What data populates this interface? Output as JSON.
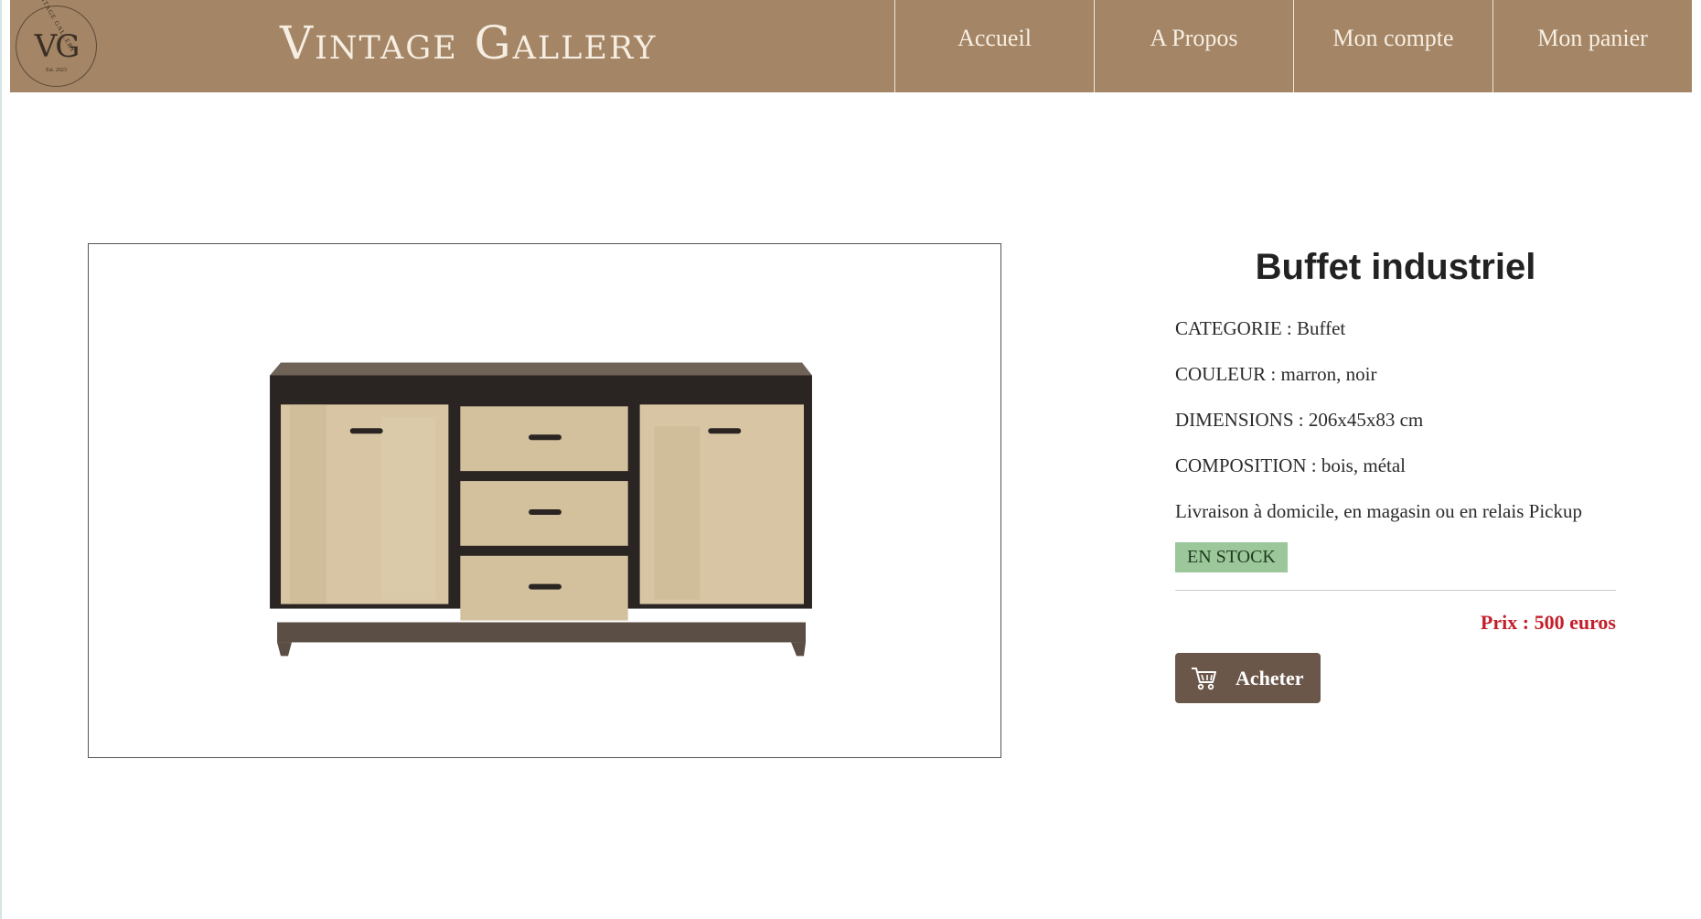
{
  "brand": {
    "logo_text": "VG",
    "logo_arc_text": "VINTAGE GALLERY",
    "logo_est": "Est. 2023",
    "title": "Vintage Gallery"
  },
  "nav": {
    "items": [
      {
        "label": "Accueil",
        "icon": ""
      },
      {
        "label": "A Propos",
        "icon": ""
      },
      {
        "label": "Mon compte",
        "icon": ""
      },
      {
        "label": "Mon panier",
        "icon": ""
      }
    ]
  },
  "product": {
    "title": "Buffet industriel",
    "image_alt_icon": "sideboard-image",
    "specs": [
      "CATEGORIE : Buffet",
      "COULEUR : marron, noir",
      "DIMENSIONS : 206x45x83 cm",
      "COMPOSITION : bois, métal",
      "Livraison à domicile, en magasin ou en relais Pickup"
    ],
    "stock": "EN STOCK",
    "price": "Prix : 500 euros",
    "buy_label": "Acheter",
    "buy_icon": "cart-icon"
  },
  "colors": {
    "header": "#a48565",
    "stock_badge": "#9bc79a",
    "price": "#c4202b",
    "buy_button": "#6b574a"
  }
}
